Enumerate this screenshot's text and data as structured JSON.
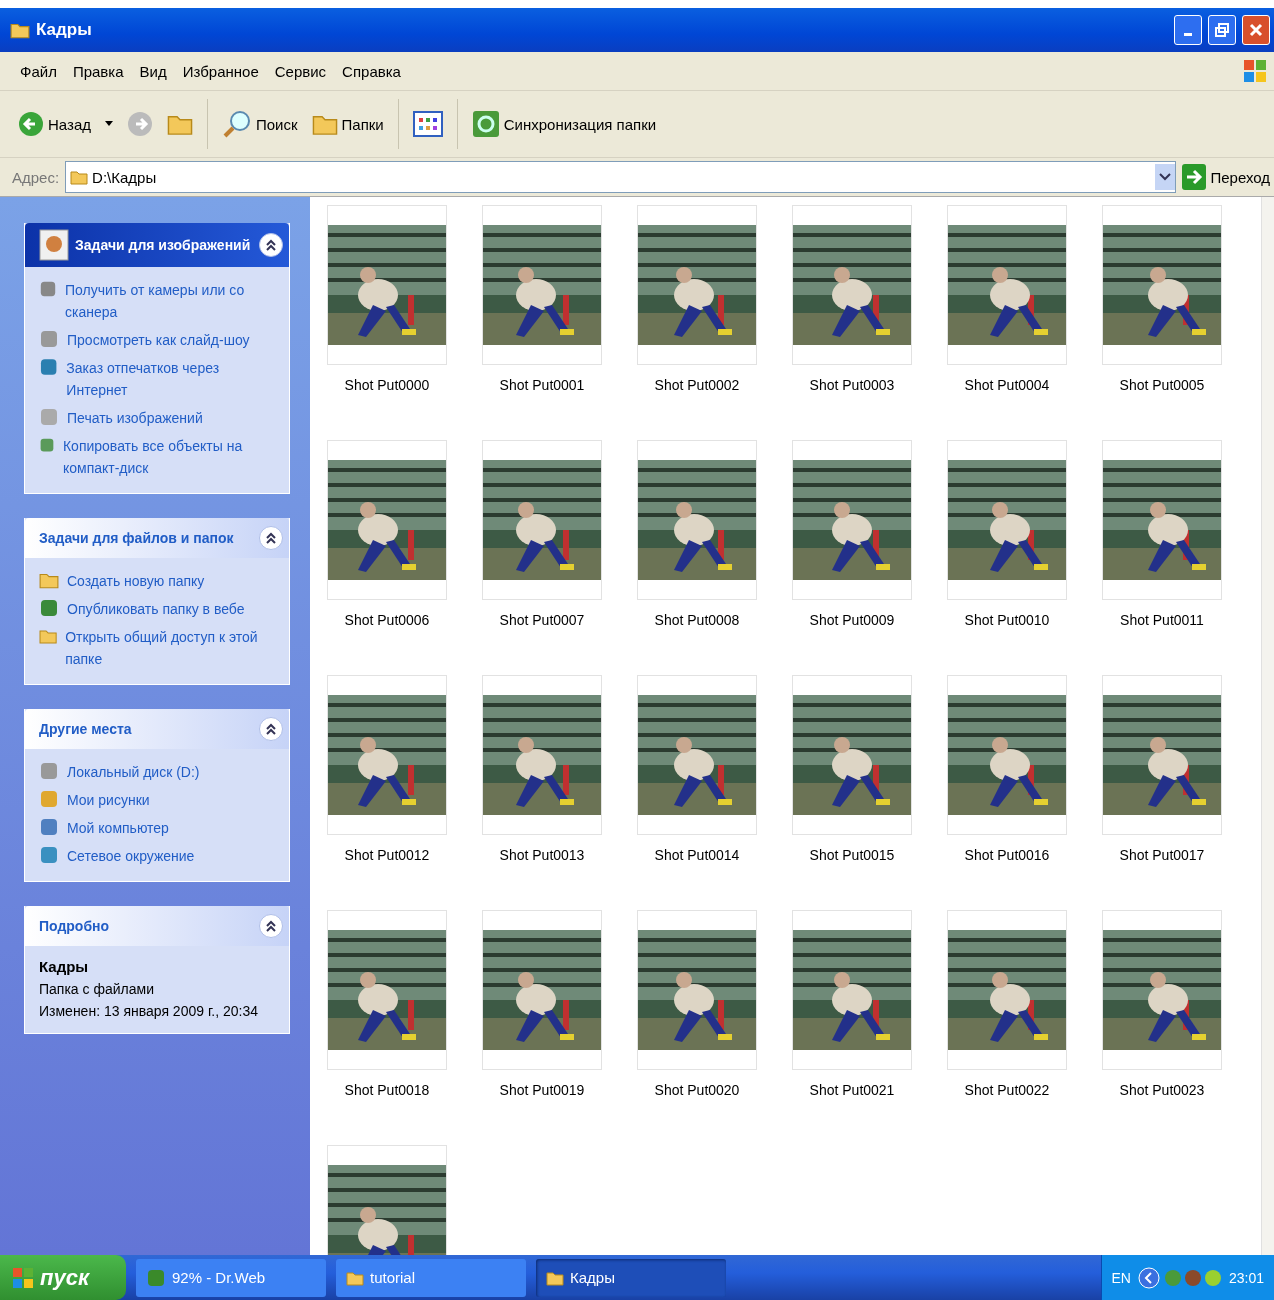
{
  "window": {
    "title": "Кадры"
  },
  "menu": [
    "Файл",
    "Правка",
    "Вид",
    "Избранное",
    "Сервис",
    "Справка"
  ],
  "toolbar": {
    "back": "Назад",
    "search": "Поиск",
    "folders": "Папки",
    "sync": "Синхронизация папки"
  },
  "address": {
    "label": "Адрес:",
    "value": "D:\\Кадры",
    "go": "Переход"
  },
  "sidebar": [
    {
      "kind": "special",
      "title": "Задачи для изображений",
      "expanded": true,
      "items": [
        "Получить от камеры или со сканера",
        "Просмотреть как слайд-шоу",
        "Заказ отпечатков через Интернет",
        "Печать изображений",
        "Копировать все объекты на компакт-диск"
      ]
    },
    {
      "kind": "normal",
      "title": "Задачи для файлов и папок",
      "expanded": true,
      "items": [
        "Создать новую папку",
        "Опубликовать папку в вебе",
        "Открыть общий доступ к этой папке"
      ]
    },
    {
      "kind": "normal",
      "title": "Другие места",
      "expanded": true,
      "items": [
        "Локальный диск (D:)",
        "Мои рисунки",
        "Мой компьютер",
        "Сетевое окружение"
      ]
    },
    {
      "kind": "details",
      "title": "Подробно",
      "expanded": true,
      "name": "Кадры",
      "type": "Папка с файлами",
      "modified": "Изменен: 13 января 2009 г., 20:34"
    }
  ],
  "thumbnails": [
    {
      "label": "Shot Put0000"
    },
    {
      "label": "Shot Put0001"
    },
    {
      "label": "Shot Put0002"
    },
    {
      "label": "Shot Put0003"
    },
    {
      "label": "Shot Put0004"
    },
    {
      "label": "Shot Put0005"
    },
    {
      "label": "Shot Put0006"
    },
    {
      "label": "Shot Put0007"
    },
    {
      "label": "Shot Put0008"
    },
    {
      "label": "Shot Put0009"
    },
    {
      "label": "Shot Put0010"
    },
    {
      "label": "Shot Put0011"
    },
    {
      "label": "Shot Put0012"
    },
    {
      "label": "Shot Put0013"
    },
    {
      "label": "Shot Put0014"
    },
    {
      "label": "Shot Put0015"
    },
    {
      "label": "Shot Put0016"
    },
    {
      "label": "Shot Put0017"
    },
    {
      "label": "Shot Put0018"
    },
    {
      "label": "Shot Put0019"
    },
    {
      "label": "Shot Put0020"
    },
    {
      "label": "Shot Put0021"
    },
    {
      "label": "Shot Put0022"
    },
    {
      "label": "Shot Put0023"
    },
    {
      "kind": "picture"
    }
  ],
  "taskbar": {
    "start": "пуск",
    "tasks": [
      {
        "label": "92% - Dr.Web",
        "selected": false
      },
      {
        "label": "tutorial",
        "selected": false
      },
      {
        "label": "Кадры",
        "selected": true
      }
    ],
    "language": "EN",
    "clock": "23:01"
  }
}
